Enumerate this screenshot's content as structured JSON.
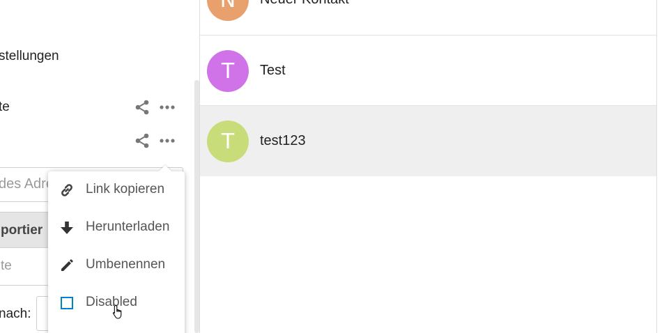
{
  "left_panel": {
    "settings_label": "stellungen",
    "rows": [
      {
        "label": "te"
      },
      {
        "label": ""
      }
    ],
    "address_placeholder": "des Adre",
    "import_button_label": "portier",
    "select_value": "te",
    "sort_label": "nach:"
  },
  "menu": {
    "items": [
      {
        "label": "Link kopieren",
        "icon": "link-icon"
      },
      {
        "label": "Herunterladen",
        "icon": "download-icon"
      },
      {
        "label": "Umbenennen",
        "icon": "pencil-icon"
      },
      {
        "label": "Disabled",
        "icon": "checkbox-icon"
      }
    ],
    "checkbox_color": "#0082c9"
  },
  "contacts": [
    {
      "initial": "N",
      "name": "Neuer Kontakt",
      "color": "#e8a06c",
      "selected": false
    },
    {
      "initial": "T",
      "name": "Test",
      "color": "#d073e8",
      "selected": false
    },
    {
      "initial": "T",
      "name": "test123",
      "color": "#c9dc7a",
      "selected": true
    }
  ]
}
